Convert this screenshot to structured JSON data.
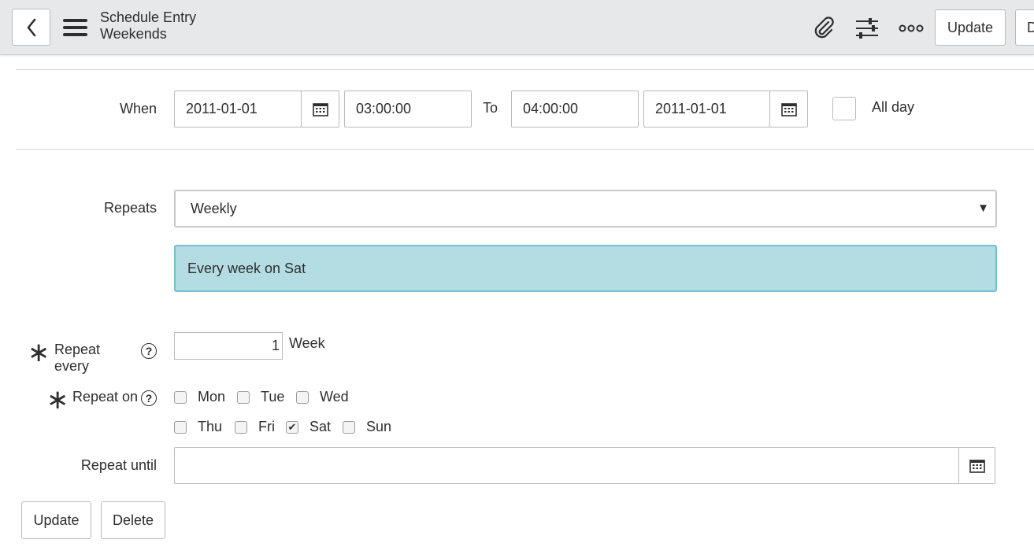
{
  "header": {
    "title": "Schedule Entry",
    "subtitle": "Weekends",
    "update_label": "Update",
    "cut_button_label": "D"
  },
  "when": {
    "label": "When",
    "start_date": "2011-01-01",
    "start_time": "03:00:00",
    "to_label": "To",
    "end_time": "04:00:00",
    "end_date": "2011-01-01",
    "all_day_label": "All day",
    "all_day_checked": false
  },
  "repeats": {
    "label": "Repeats",
    "selected": "Weekly",
    "summary": "Every week on Sat"
  },
  "repeat_every": {
    "label": "Repeat every",
    "value": "1",
    "unit": "Week",
    "required": true
  },
  "repeat_on": {
    "label": "Repeat on",
    "required": true,
    "days": [
      {
        "label": "Mon",
        "checked": false
      },
      {
        "label": "Tue",
        "checked": false
      },
      {
        "label": "Wed",
        "checked": false
      },
      {
        "label": "Thu",
        "checked": false
      },
      {
        "label": "Fri",
        "checked": false
      },
      {
        "label": "Sat",
        "checked": true
      },
      {
        "label": "Sun",
        "checked": false
      }
    ]
  },
  "repeat_until": {
    "label": "Repeat until",
    "value": ""
  },
  "footer": {
    "update_label": "Update",
    "delete_label": "Delete"
  },
  "icons": {
    "back": "chevron-left-icon",
    "menu": "hamburger-menu-icon",
    "attachment": "paperclip-icon",
    "personalize": "sliders-icon",
    "more": "more-options-icon",
    "calendar": "calendar-icon",
    "help": "help-icon",
    "required": "asterisk-icon"
  }
}
